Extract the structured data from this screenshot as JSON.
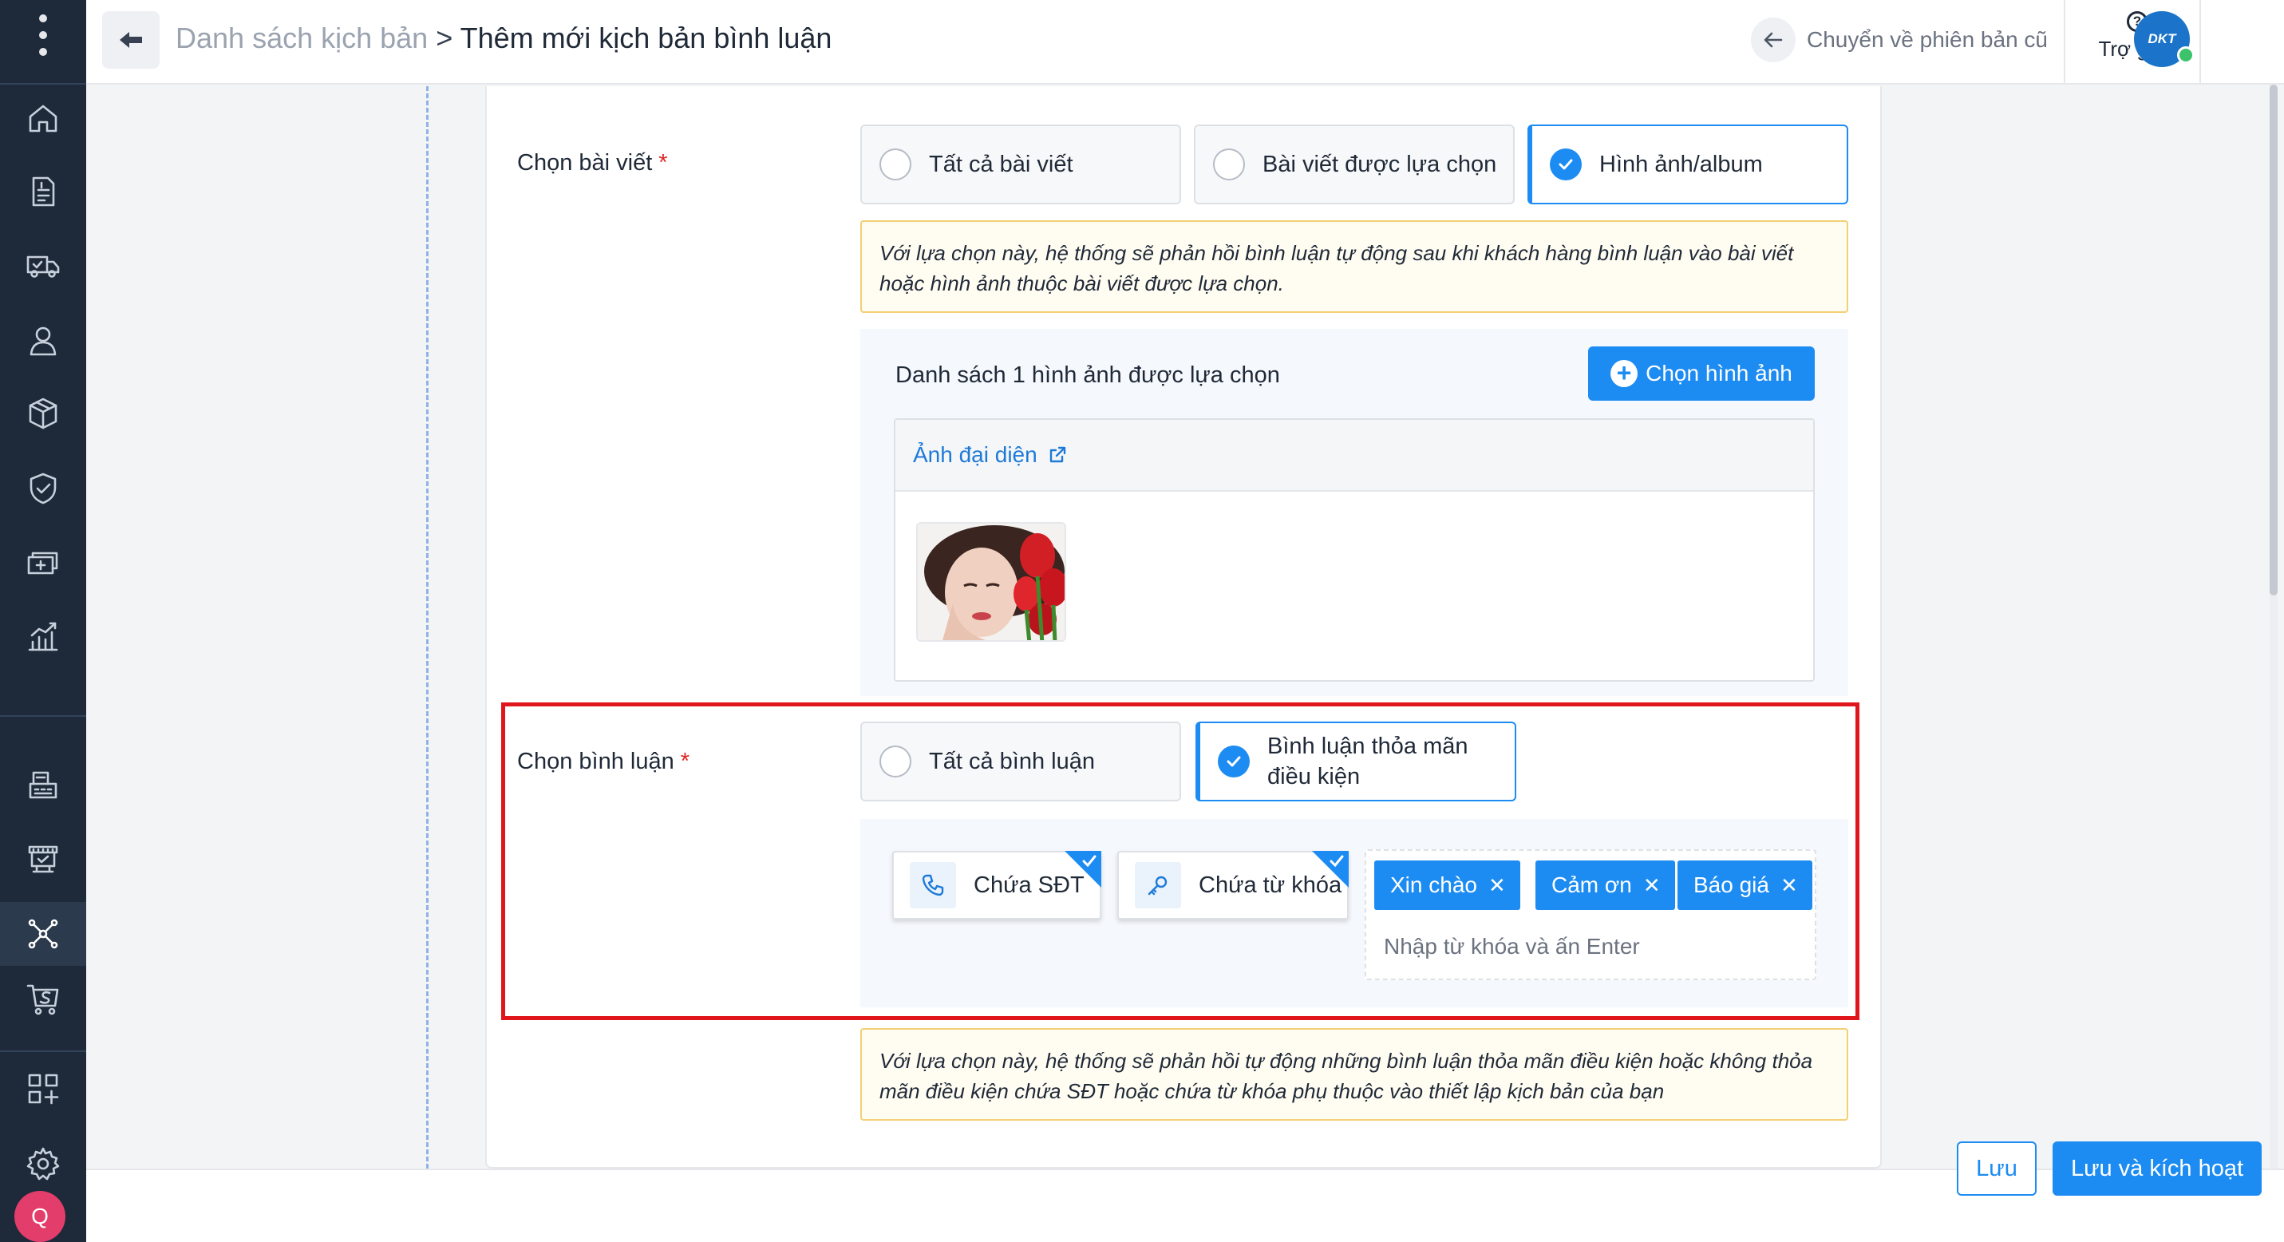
{
  "header": {
    "breadcrumb_parent": "Danh sách kịch bản",
    "breadcrumb_separator": ">",
    "breadcrumb_current": "Thêm mới kịch bản bình luận",
    "old_version_label": "Chuyển về phiên bản cũ",
    "help_label": "Trợ giúp",
    "brand_logo_text": "DKT"
  },
  "sidebar": {
    "icons": [
      "menu-dots-icon",
      "home-icon",
      "orders-icon",
      "delivery-truck-icon",
      "customer-icon",
      "product-box-icon",
      "shield-check-icon",
      "cashbook-icon",
      "report-chart-icon",
      "pos-register-icon",
      "store-display-icon",
      "integration-network-icon",
      "shopping-cart-s-icon",
      "apps-grid-icon",
      "settings-gear-icon"
    ],
    "active_icon": "integration-network-icon",
    "user_initial": "Q"
  },
  "post_section": {
    "label": "Chọn bài viết",
    "required_mark": "*",
    "options": [
      {
        "label": "Tất cả bài viết",
        "selected": false
      },
      {
        "label": "Bài viết được lựa chọn",
        "selected": false
      },
      {
        "label": "Hình ảnh/album",
        "selected": true
      }
    ],
    "note": "Với lựa chọn này, hệ thống sẽ phản hồi bình luận tự động sau khi khách hàng bình luận vào bài viết hoặc hình ảnh thuộc bài viết được lựa chọn."
  },
  "image_panel": {
    "title": "Danh sách 1 hình ảnh được lựa chọn",
    "choose_button": "Chọn hình ảnh",
    "link_label": "Ảnh đại diện"
  },
  "comment_section": {
    "label": "Chọn bình luận",
    "required_mark": "*",
    "options": [
      {
        "label": "Tất cả bình luận",
        "selected": false
      },
      {
        "label_line1": "Bình luận thỏa mãn",
        "label_line2": "điều kiện",
        "selected": true
      }
    ],
    "conditions": [
      {
        "label": "Chứa SĐT",
        "icon": "phone-icon",
        "checked": true
      },
      {
        "label": "Chứa từ khóa",
        "icon": "key-icon",
        "checked": true
      }
    ],
    "keywords": [
      "Xin chào",
      "Cảm ơn",
      "Báo giá"
    ],
    "keyword_placeholder": "Nhập từ khóa và ấn Enter",
    "note": "Với lựa chọn này, hệ thống sẽ phản hồi tự động những bình luận thỏa mãn điều kiện hoặc không thỏa mãn điều kiện chứa SĐT hoặc chứa từ khóa phụ thuộc vào thiết lập kịch bản của bạn"
  },
  "footer": {
    "save_label": "Lưu",
    "save_activate_label": "Lưu và kích hoạt"
  },
  "colors": {
    "primary": "#1d8cf2",
    "sidebar_bg": "#1e2a3a",
    "highlight_frame": "#e0161c",
    "note_border": "#f3cf75"
  }
}
